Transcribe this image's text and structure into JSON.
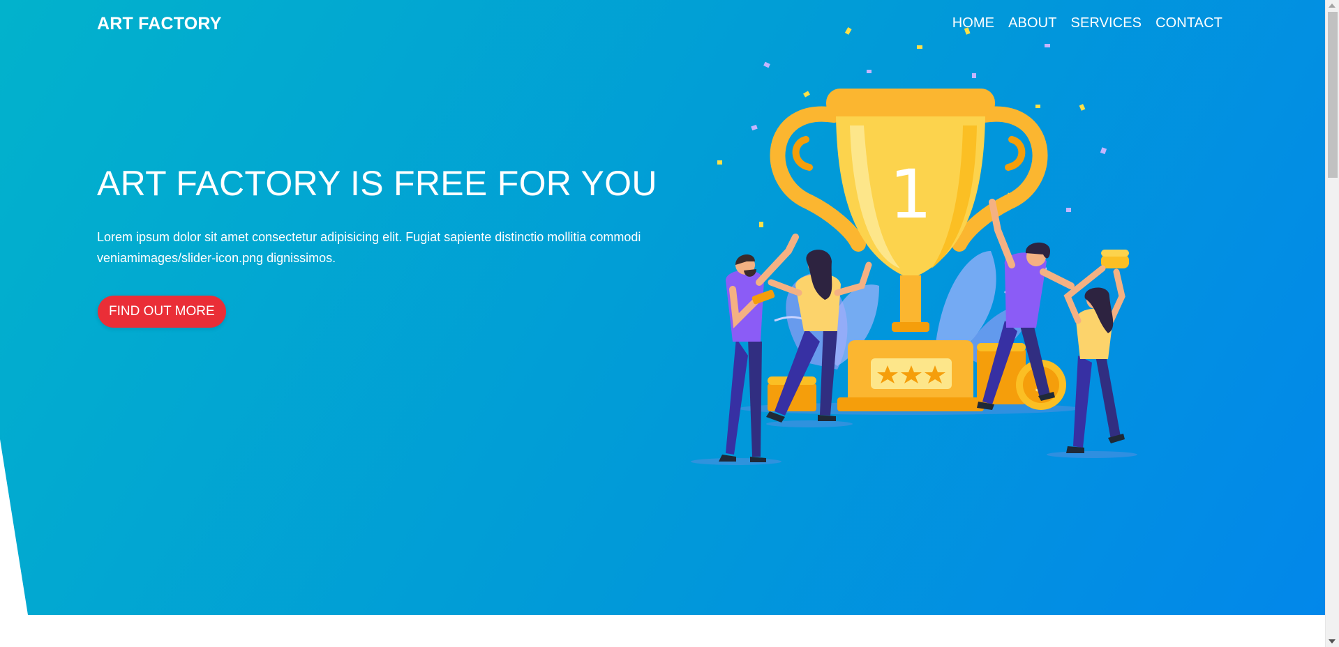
{
  "header": {
    "brand": "ART FACTORY",
    "nav": [
      "HOME",
      "ABOUT",
      "SERVICES",
      "CONTACT"
    ]
  },
  "hero": {
    "headline": "ART FACTORY IS FREE FOR YOU",
    "lead": "Lorem ipsum dolor sit amet consectetur adipisicing elit. Fugiat sapiente distinctio mollitia commodi veniamimages/slider-icon.png dignissimos.",
    "cta_label": "FIND OUT MORE",
    "trophy_number": "1"
  },
  "colors": {
    "accent": "#ea2e37",
    "gradient_start": "#02b2cc",
    "gradient_end": "#0287ea",
    "trophy": "#fbb630"
  },
  "icons": {
    "illustration": "trophy-celebration-illustration"
  }
}
